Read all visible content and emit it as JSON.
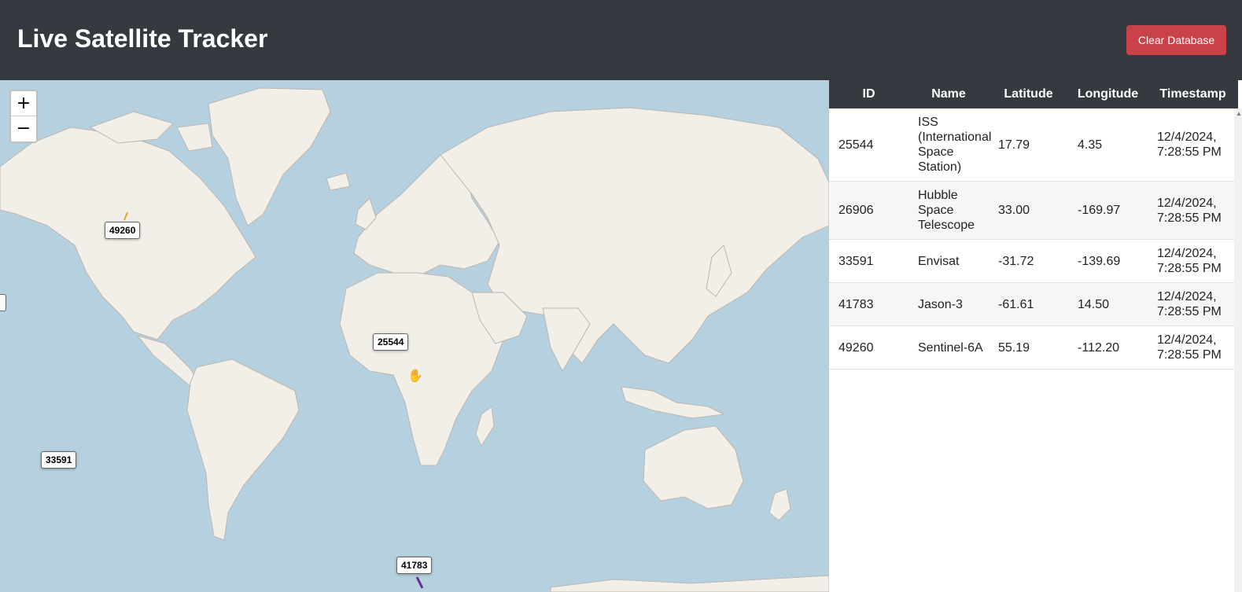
{
  "header": {
    "title": "Live Satellite Tracker",
    "clear_button": "Clear Database"
  },
  "map": {
    "zoom_in": "+",
    "zoom_out": "−",
    "markers": [
      {
        "id": "49260",
        "track_color": "#e0a82e"
      },
      {
        "id": "25544"
      },
      {
        "id": "33591"
      },
      {
        "id": "41783",
        "track_color": "#6a2c91"
      }
    ]
  },
  "table": {
    "headers": [
      "ID",
      "Name",
      "Latitude",
      "Longitude",
      "Timestamp"
    ],
    "rows": [
      {
        "id": "25544",
        "name": "ISS (International Space Station)",
        "lat": "17.79",
        "lon": "4.35",
        "ts": "12/4/2024, 7:28:55 PM"
      },
      {
        "id": "26906",
        "name": "Hubble Space Telescope",
        "lat": "33.00",
        "lon": "-169.97",
        "ts": "12/4/2024, 7:28:55 PM"
      },
      {
        "id": "33591",
        "name": "Envisat",
        "lat": "-31.72",
        "lon": "-139.69",
        "ts": "12/4/2024, 7:28:55 PM"
      },
      {
        "id": "41783",
        "name": "Jason-3",
        "lat": "-61.61",
        "lon": "14.50",
        "ts": "12/4/2024, 7:28:55 PM"
      },
      {
        "id": "49260",
        "name": "Sentinel-6A",
        "lat": "55.19",
        "lon": "-112.20",
        "ts": "12/4/2024, 7:28:55 PM"
      }
    ]
  },
  "colors": {
    "header_bg": "#343a40",
    "danger": "#c9424a",
    "ocean": "#b5d0de",
    "land": "#f2efe9"
  }
}
